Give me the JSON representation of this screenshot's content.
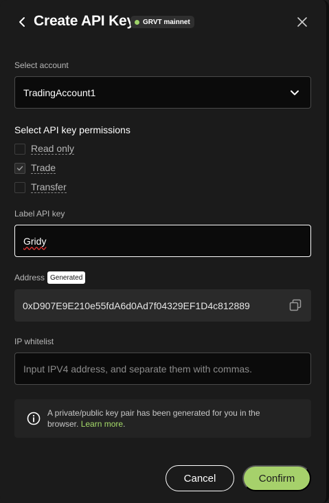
{
  "header": {
    "title": "Create API Key",
    "network_badge": "GRVT mainnet",
    "back_icon": "chevron-left-icon",
    "close_icon": "close-icon"
  },
  "account": {
    "label": "Select account",
    "selected": "TradingAccount1"
  },
  "permissions": {
    "title": "Select API key permissions",
    "items": [
      {
        "label": "Read only",
        "checked": false
      },
      {
        "label": "Trade",
        "checked": true
      },
      {
        "label": "Transfer",
        "checked": false
      }
    ]
  },
  "label_field": {
    "label": "Label API key",
    "value": "Gridy"
  },
  "address": {
    "label": "Address",
    "badge": "Generated",
    "value": "0xD907E9E210e55fdA6d0Ad7f04329EF1D4c812889"
  },
  "ip_whitelist": {
    "label": "IP whitelist",
    "placeholder": "Input IPV4 address, and separate them with commas."
  },
  "notice": {
    "text": "A private/public key pair has been generated for you in the browser.",
    "link": "Learn more",
    "trailing": "."
  },
  "actions": {
    "cancel": "Cancel",
    "confirm": "Confirm"
  },
  "colors": {
    "accent": "#a6d16b",
    "background": "#1b1b1b",
    "network_dot": "#9fd46a"
  }
}
